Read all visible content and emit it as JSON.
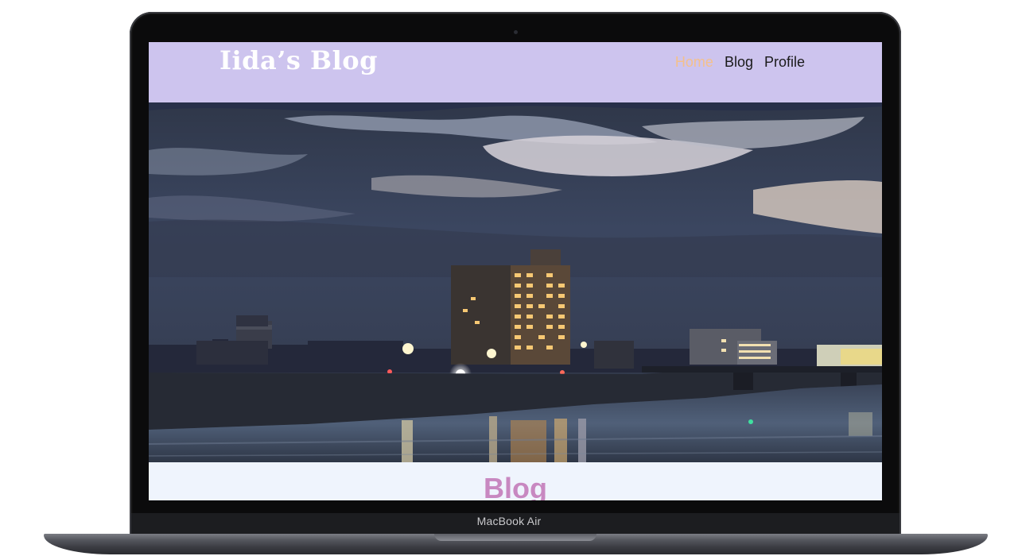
{
  "device": {
    "label": "MacBook Air"
  },
  "site": {
    "logo": "Iida’s Blog",
    "nav": [
      {
        "label": "Home",
        "active": true
      },
      {
        "label": "Blog",
        "active": false
      },
      {
        "label": "Profile",
        "active": false
      }
    ]
  },
  "hero": {
    "image_description_name": "night-river-cityscape-photo"
  },
  "section": {
    "title": "Blog"
  },
  "colors": {
    "header_bg": "#cdc4ee",
    "nav_active": "#f4c08c",
    "section_title": "#c888c1",
    "page_bg": "#eff4fd"
  }
}
